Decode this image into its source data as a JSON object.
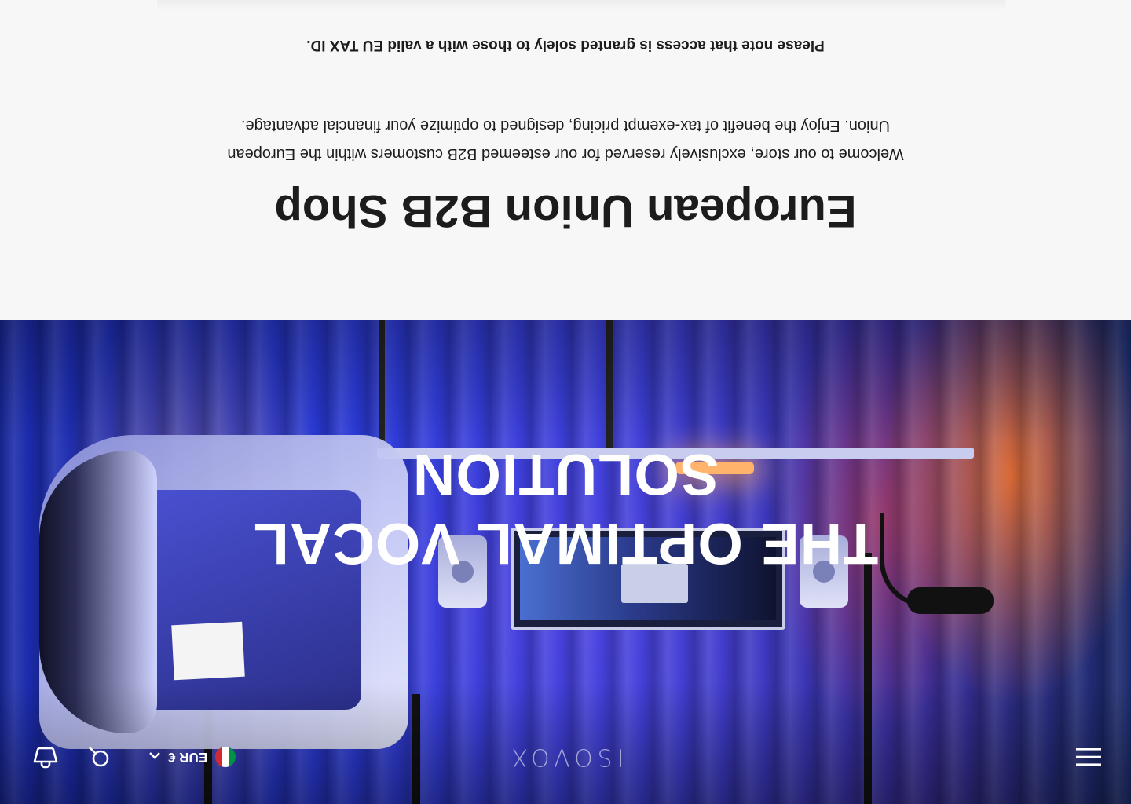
{
  "header": {
    "menu_icon": "hamburger-menu-icon",
    "logo_text": "ISOVOX",
    "locale": {
      "flag": "italy-flag",
      "flag_colors": [
        "#009246",
        "#ffffff",
        "#ce2b37"
      ],
      "currency": "EUR €",
      "chevron_icon": "chevron-up-icon"
    },
    "search_icon": "search-icon",
    "cart_icon": "cart-icon"
  },
  "hero": {
    "title_line_1": "THE OPTIMAL VOCAL",
    "title_line_2": "SOLUTION",
    "accent": "#3b3fd8"
  },
  "intro": {
    "title": "European Union B2B Shop",
    "text": "Welcome to our store, exclusively reserved for our esteemed B2B customers within the European Union. Enjoy the benefit of tax-exempt pricing, designed to optimize your financial advantage.",
    "note": "Please note that access is granted solely to those with a valid EU TAX ID."
  }
}
